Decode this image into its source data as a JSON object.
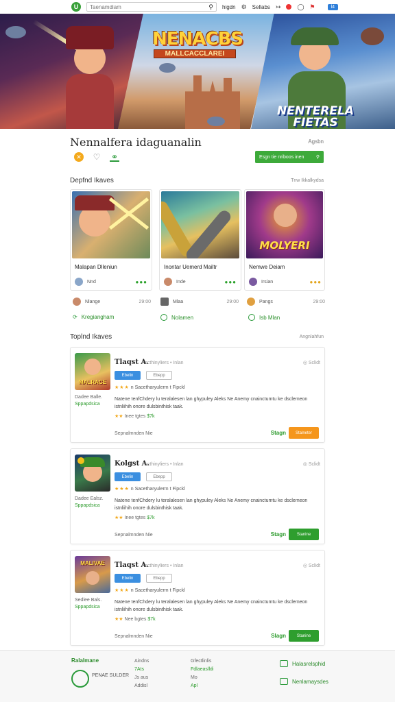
{
  "topbar": {
    "logo_letter": "U",
    "search_placeholder": "Taenamdiam",
    "search_icon": "search-icon",
    "nav": [
      "higdn",
      "Sellabs"
    ],
    "count": "l4"
  },
  "hero": {
    "center_title": "NENACBS",
    "center_subtitle": "MALLCACCLAREI",
    "right_title": "NENTERELA FIETAS"
  },
  "page": {
    "title": "Nennalfera idaguanalin",
    "title_right": "Agsbn",
    "cta_label": "Esgn tie nriboos inen",
    "cta_icon": "search-icon"
  },
  "featured": {
    "heading": "Depfnd Ikaves",
    "right": "Tnw Ikkalkydsa",
    "cards": [
      {
        "name": "Malapan Dlleniun",
        "meta": "Nnd",
        "sub": "Nlange",
        "time": "29:00",
        "link": "Kregiangham",
        "dots": "gold-no"
      },
      {
        "name": "Inontar Uemerd Mailtr",
        "meta": "Inde",
        "sub": "Mlaa",
        "time": "29:00",
        "link": "Nolamen",
        "dots": "gold-no"
      },
      {
        "name": "Nemwe Deiam",
        "meta": "Irsian",
        "sub": "Pangs",
        "time": "29:00",
        "link": "Isb Mlan",
        "dots": "gold"
      }
    ]
  },
  "list": {
    "heading": "Toplnd Ikaves",
    "right": "Angnlahfun",
    "items": [
      {
        "name": "Tlaqst A.",
        "small": "• scthinyliers • Inlan",
        "flag": "Sclidt",
        "tag1": "Ebelin",
        "tag2": "Ebepp",
        "rating": "n Sacetharyulerm t Fipckl",
        "desc": "Natene tenfChdery lu teralalesen lan ghypuley Aleks Ne Anemy cnainctumtu ke dsclemeon istnliihih onore dulsbinthisk taak.",
        "row": "Inee tgtes",
        "row_green": "$7k",
        "side1": "Dadee Balle.",
        "side2": "Sppapdsica",
        "foot": "Sepnalmnden Nie",
        "status": "Stagn",
        "btn": "Stalneter",
        "btn_color": "#f5961c"
      },
      {
        "name": "Kolgst A.",
        "small": "• scthinyliers • Inlan",
        "flag": "Sclidt",
        "tag1": "Ebelin",
        "tag2": "Ebepp",
        "rating": "n Sacetharyulerm t Fipckl",
        "desc": "Natene tenfChdery lu teralalesen lan ghypuley Aleks Ne Anemy cnainctumtu ke dsclemeon istnliihih onore dulsbinthisk taak.",
        "row": "Inee tgtes",
        "row_green": "$7k",
        "side1": "Dadee Ealsz.",
        "side2": "Sppapdsica",
        "foot": "Sepnalmnden Nie",
        "status": "Stagn",
        "btn": "Stanine",
        "btn_color": "#2e9e2e"
      },
      {
        "name": "Tlaqst A.",
        "small": "• scthinyliers • Inlan",
        "flag": "Sclidt",
        "tag1": "Ebelin",
        "tag2": "Ebepp",
        "rating": "n Sacetharyulerm t Fipckl",
        "desc": "Natene tenfChdery lu teralalesen lan ghypuley Aleks Ne Anemy cnainctumtu ke dsclemeon istnliihih onore dulsbinthisk taak.",
        "row": "Nee bgtes",
        "row_green": "$7k",
        "side1": "Sedlee Bals.",
        "side2": "Sppapdsica",
        "foot": "Sepnalmnden Nie",
        "status": "Slagn",
        "btn": "Stanine",
        "btn_color": "#2e9e2e"
      }
    ]
  },
  "footer": {
    "brand": "Ralalmane",
    "logo_text": "PENAE SULDER",
    "col1": [
      "Aindns",
      "7Ats",
      "Js aus",
      "Addisl"
    ],
    "col2": [
      "Gfectlinlis",
      "Fdlaeaslldi",
      "Mo",
      "Apl"
    ],
    "link1": "Halasrelsphid",
    "link2": "Nenlamaysdes"
  },
  "colors": {
    "accent": "#3daa3a",
    "blue": "#3b8fe0",
    "orange": "#f5961c"
  }
}
